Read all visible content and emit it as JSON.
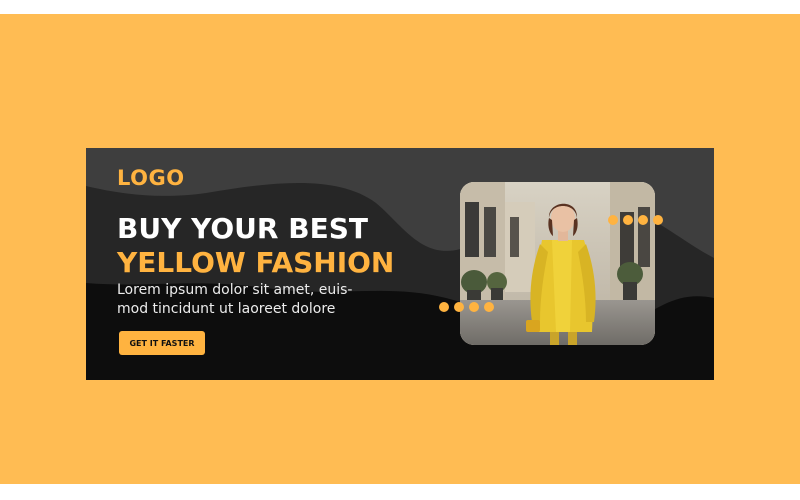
{
  "banner": {
    "logo": "LOGO",
    "headline_line1": "BUY YOUR BEST",
    "headline_line2": "YELLOW FASHION",
    "body_line1": "Lorem ipsum dolor sit amet, euis-",
    "body_line2": "mod tincidunt ut laoreet dolore",
    "cta_label": "GET IT FASTER"
  },
  "colors": {
    "page_background": "#FFBC53",
    "banner_background": "#0d0d0d",
    "accent": "#FFB340",
    "wave_light": "#3e3e3e",
    "wave_dark": "#262626"
  },
  "photo": {
    "subject": "woman-in-yellow-coat"
  },
  "decorations": {
    "dot_count_top": 4,
    "dot_count_bottom": 4
  }
}
